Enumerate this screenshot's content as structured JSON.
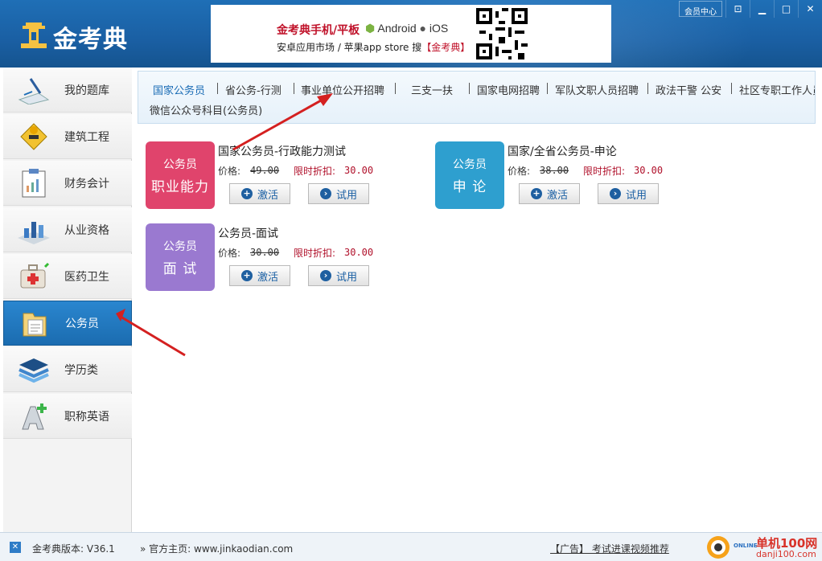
{
  "app": {
    "name": "金考典",
    "member_center": "会员中心"
  },
  "banner": {
    "headline": "金考典手机/平板",
    "os_android": "Android",
    "os_ios": "iOS",
    "sub_prefix": "安卓应用市场 / 苹果app store 搜",
    "sub_brand": "【金考典】"
  },
  "sidebar": {
    "items": [
      {
        "label": "我的题库",
        "icon": "pen-paper-icon"
      },
      {
        "label": "建筑工程",
        "icon": "construction-icon"
      },
      {
        "label": "财务会计",
        "icon": "clipboard-icon"
      },
      {
        "label": "从业资格",
        "icon": "chart-icon"
      },
      {
        "label": "医药卫生",
        "icon": "medical-kit-icon"
      },
      {
        "label": "公务员",
        "icon": "folder-icon",
        "active": true
      },
      {
        "label": "学历类",
        "icon": "layers-icon"
      },
      {
        "label": "职称英语",
        "icon": "letter-a-icon"
      }
    ]
  },
  "tabs": {
    "row1": [
      "国家公务员",
      "省公务-行测",
      "事业单位公开招聘",
      "三支一扶",
      "国家电网招聘",
      "军队文职人员招聘",
      "政法干警 公安",
      "社区专职工作人员"
    ],
    "row2": "微信公众号科目(公务员)",
    "active": "国家公务员"
  },
  "products": [
    {
      "thumb_top": "公务员",
      "thumb_bottom": "职业能力",
      "color": "#e0446c",
      "title": "国家公务员-行政能力测试",
      "price_label": "价格:",
      "price_old": "49.00",
      "discount_label": "限时折扣:",
      "discount_price": "30.00",
      "activate": "激活",
      "trial": "试用"
    },
    {
      "thumb_top": "公务员",
      "thumb_bottom": "申 论",
      "color": "#2e9fcf",
      "title": "国家/全省公务员-申论",
      "price_label": "价格:",
      "price_old": "38.00",
      "discount_label": "限时折扣:",
      "discount_price": "30.00",
      "activate": "激活",
      "trial": "试用"
    },
    {
      "thumb_top": "公务员",
      "thumb_bottom": "面 试",
      "color": "#9a79d0",
      "title": "公务员-面试",
      "price_label": "价格:",
      "price_old": "30.00",
      "discount_label": "限时折扣:",
      "discount_price": "30.00",
      "activate": "激活",
      "trial": "试用"
    }
  ],
  "status": {
    "version": "金考典版本: V36.1",
    "homepage": "官方主页: www.jinkaodian.com",
    "ad": "【广告】 考试进课视频推荐",
    "watermark_top": "单机100网",
    "watermark_bottom": "danji100.com",
    "watermark_online": "ONLINE"
  }
}
